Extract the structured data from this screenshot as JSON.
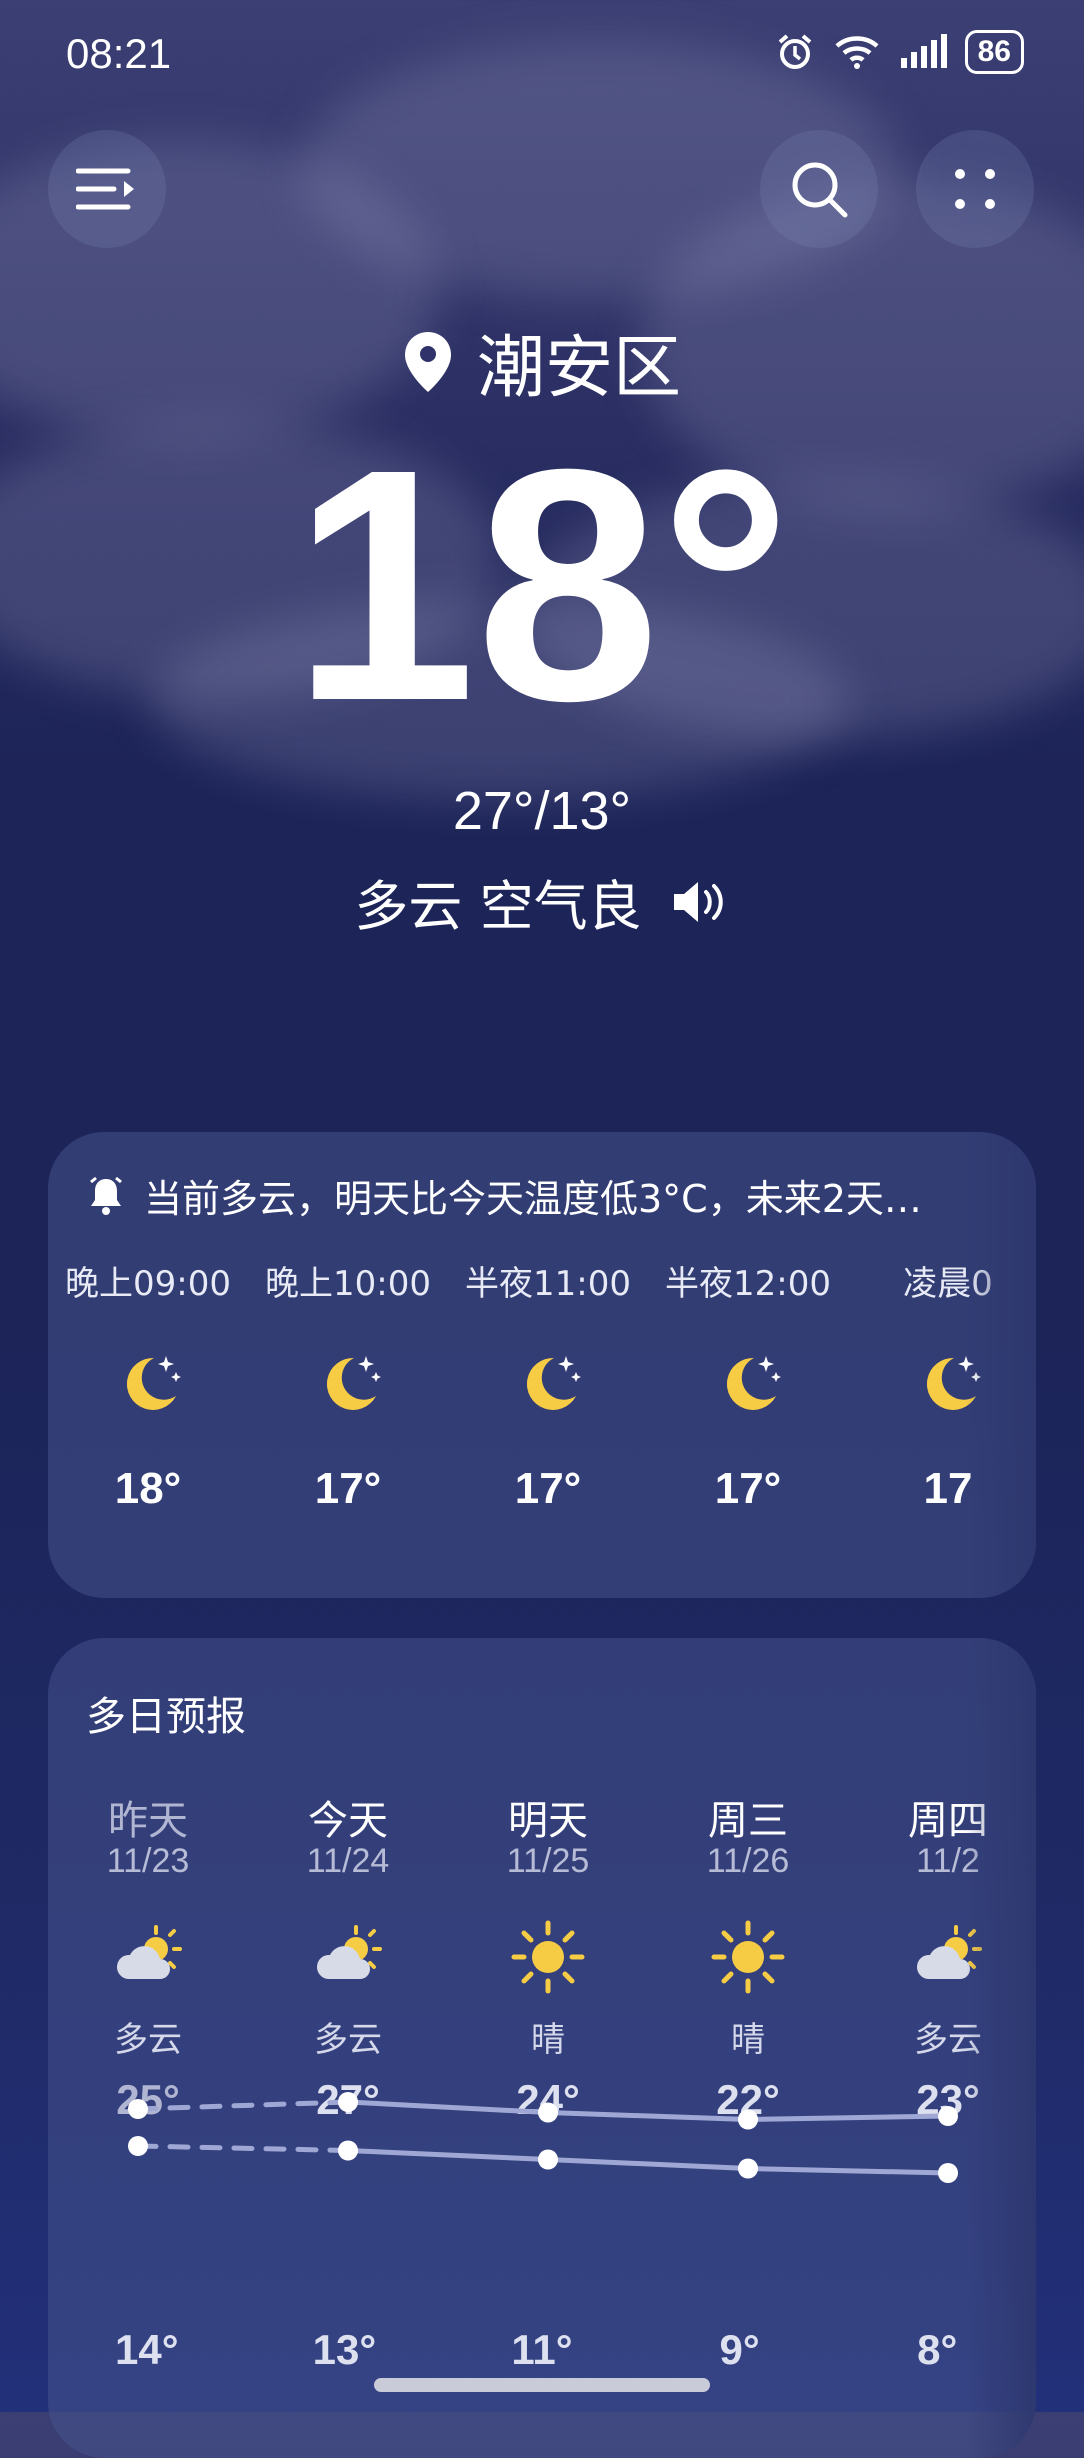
{
  "status_bar": {
    "time": "08:21",
    "battery": "86"
  },
  "location": {
    "name": "潮安区"
  },
  "current": {
    "temp": "18°",
    "hi_lo": "27°/13°",
    "condition": "多云 空气良"
  },
  "hourly": {
    "alert": "当前多云，明天比今天温度低3°C，未来2天…",
    "items": [
      {
        "time": "晚上09:00",
        "icon": "moon-stars-icon",
        "temp": "18°"
      },
      {
        "time": "晚上10:00",
        "icon": "moon-stars-icon",
        "temp": "17°"
      },
      {
        "time": "半夜11:00",
        "icon": "moon-stars-icon",
        "temp": "17°"
      },
      {
        "time": "半夜12:00",
        "icon": "moon-stars-icon",
        "temp": "17°"
      },
      {
        "time": "凌晨0",
        "icon": "moon-stars-icon",
        "temp": "17"
      }
    ]
  },
  "daily": {
    "title": "多日预报",
    "items": [
      {
        "name": "昨天",
        "date": "11/23",
        "icon": "partly-cloudy-icon",
        "cond": "多云",
        "high": "25°",
        "low": "14°",
        "high_val": 25,
        "low_val": 14
      },
      {
        "name": "今天",
        "date": "11/24",
        "icon": "partly-cloudy-icon",
        "cond": "多云",
        "high": "27°",
        "low": "13°",
        "high_val": 27,
        "low_val": 13
      },
      {
        "name": "明天",
        "date": "11/25",
        "icon": "sun-icon",
        "cond": "晴",
        "high": "24°",
        "low": "11°",
        "high_val": 24,
        "low_val": 11
      },
      {
        "name": "周三",
        "date": "11/26",
        "icon": "sun-icon",
        "cond": "晴",
        "high": "22°",
        "low": "9°",
        "high_val": 22,
        "low_val": 9
      },
      {
        "name": "周四",
        "date": "11/2",
        "icon": "partly-cloudy-icon",
        "cond": "多云",
        "high": "23°",
        "low": "8°",
        "high_val": 23,
        "low_val": 8
      }
    ]
  }
}
